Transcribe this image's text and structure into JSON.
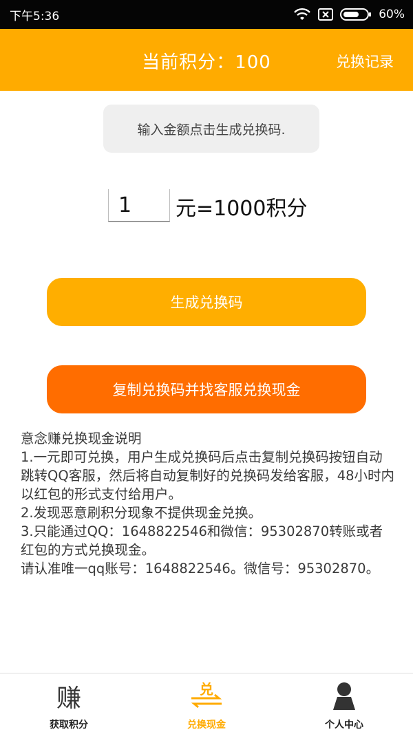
{
  "status_bar": {
    "time": "下午5:36",
    "battery": "60%",
    "icons": [
      "wifi-icon",
      "sim-off-icon",
      "battery-icon"
    ]
  },
  "header": {
    "title": "当前积分：100",
    "action": "兑换记录"
  },
  "hint": "输入金额点击生成兑换码.",
  "exchange": {
    "amount_value": "1",
    "rate_label": "元=1000积分"
  },
  "buttons": {
    "generate": "生成兑换码",
    "copy": "复制兑换码并找客服兑换现金"
  },
  "instructions": {
    "lines": [
      "意念赚兑换现金说明",
      "1.一元即可兑换，用户生成兑换码后点击复制兑换码按钮自动跳转QQ客服，然后将自动复制好的兑换码发给客服，48小时内以红包的形式支付给用户。",
      "2.发现恶意刷积分现象不提供现金兑换。",
      "3.只能通过QQ：1648822546和微信：95302870转账或者红包的方式兑换现金。",
      "请认准唯一qq账号：1648822546。微信号：95302870。"
    ]
  },
  "bottom_nav": {
    "earn_icon_char": "赚",
    "exchange_icon_char": "兑",
    "items": [
      {
        "label": "获取积分"
      },
      {
        "label": "兑换现金"
      },
      {
        "label": "个人中心"
      }
    ]
  },
  "colors": {
    "accent": "#ffab00",
    "copy_button": "#ff6d00",
    "status_bar": "#050505"
  }
}
